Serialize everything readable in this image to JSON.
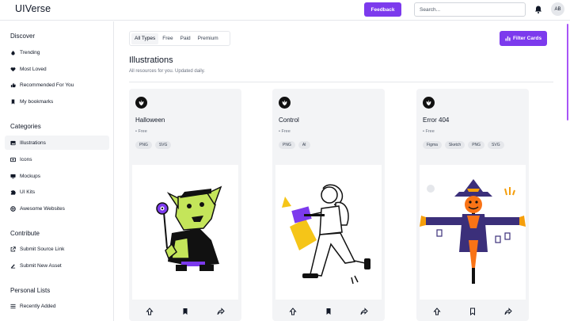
{
  "header": {
    "brand": "UIVerse",
    "feedback_label": "Feedback",
    "search_placeholder": "Search...",
    "avatar_initials": "AB"
  },
  "sidebar": {
    "discover_title": "Discover",
    "discover": [
      {
        "label": "Trending",
        "icon": "flame-icon"
      },
      {
        "label": "Most Loved",
        "icon": "heart-icon"
      },
      {
        "label": "Recommended For You",
        "icon": "thumbs-up-icon"
      },
      {
        "label": "My bookmarks",
        "icon": "bookmark-icon"
      }
    ],
    "categories_title": "Categories",
    "categories": [
      {
        "label": "Illustrations",
        "icon": "image-icon",
        "active": true
      },
      {
        "label": "Icons",
        "icon": "icons-icon"
      },
      {
        "label": "Mockups",
        "icon": "monitor-icon"
      },
      {
        "label": "UI Kits",
        "icon": "puzzle-icon"
      },
      {
        "label": "Awesome Websites",
        "icon": "globe-icon"
      }
    ],
    "contribute_title": "Contribute",
    "contribute": [
      {
        "label": "Submit Source Link",
        "icon": "external-link-icon"
      },
      {
        "label": "Submit New Asset",
        "icon": "edit-icon"
      }
    ],
    "personal_title": "Personal Lists",
    "personal": [
      {
        "label": "Recently Added",
        "icon": "list-icon"
      }
    ]
  },
  "main": {
    "tabs": [
      "All Types",
      "Free",
      "Paid",
      "Premium"
    ],
    "active_tab": "All Types",
    "filter_label": "Filter Cards",
    "title": "Illustrations",
    "subtitle": "All resources for you. Updated daily."
  },
  "cards": [
    {
      "title": "Halloween",
      "price": "• Free",
      "tags": [
        "PNG",
        "SVG"
      ],
      "art": "goblin-illustration"
    },
    {
      "title": "Control",
      "price": "• Free",
      "tags": [
        "PNG",
        "AI"
      ],
      "art": "woman-laptop-illustration"
    },
    {
      "title": "Error 404",
      "price": "• Free",
      "tags": [
        "Figma",
        "Sketch",
        "PNG",
        "SVG"
      ],
      "art": "scarecrow-illustration"
    }
  ],
  "colors": {
    "accent": "#7c3aed",
    "scrollbar": "#a855f7",
    "card_bg": "#f3f4f6"
  }
}
